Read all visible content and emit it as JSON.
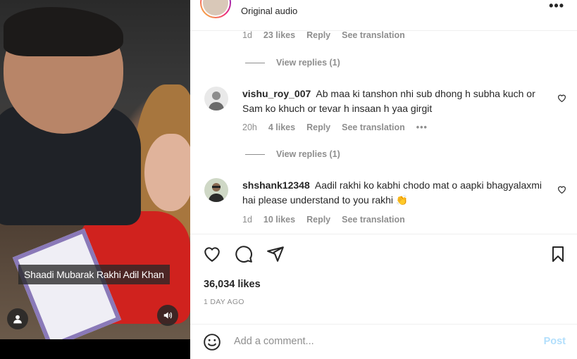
{
  "video": {
    "caption": "Shaadi Mubarak Rakhi Adil Khan"
  },
  "header": {
    "audio_label": "Original audio",
    "more_label": "•••"
  },
  "top_meta": {
    "time": "1d",
    "likes": "23 likes",
    "reply": "Reply",
    "see_translation": "See translation"
  },
  "view_replies_1": "View replies (1)",
  "comments": [
    {
      "username": "vishu_roy_007",
      "text": "Ab maa ki tanshon nhi sub dhong h subha kuch or Sam ko khuch or tevar h insaan h yaa girgit",
      "time": "20h",
      "likes": "4 likes",
      "reply": "Reply",
      "see_translation": "See translation",
      "more": "•••",
      "view_replies": "View replies (1)"
    },
    {
      "username": "shshank12348",
      "text": "Aadil rakhi ko kabhi chodo mat o aapki bhagyalaxmi hai please understand to you rakhi 👏",
      "time": "1d",
      "likes": "10 likes",
      "reply": "Reply",
      "see_translation": "See translation"
    }
  ],
  "post": {
    "likes": "36,034 likes",
    "date": "1 DAY AGO"
  },
  "add_comment": {
    "placeholder": "Add a comment...",
    "post_label": "Post"
  },
  "colors": {
    "link_blue_disabled": "#b2dffc",
    "secondary_text": "#8e8e8e",
    "primary_text": "#262626"
  }
}
